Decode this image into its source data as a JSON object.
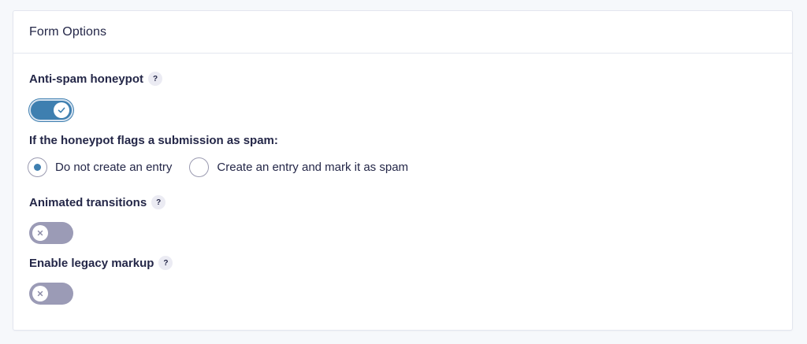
{
  "panel": {
    "title": "Form Options"
  },
  "honeypot": {
    "label": "Anti-spam honeypot",
    "help": "?",
    "enabled": true
  },
  "spam_action": {
    "label": "If the honeypot flags a submission as spam:",
    "options": [
      {
        "label": "Do not create an entry",
        "selected": true
      },
      {
        "label": "Create an entry and mark it as spam",
        "selected": false
      }
    ]
  },
  "animated_transitions": {
    "label": "Animated transitions",
    "help": "?",
    "enabled": false
  },
  "legacy_markup": {
    "label": "Enable legacy markup",
    "help": "?",
    "enabled": false
  },
  "colors": {
    "accent": "#3e7fb0",
    "toggle_off": "#9b9bb6",
    "text": "#242748"
  },
  "icons": {
    "toggle_on": "check-icon",
    "toggle_off": "x-icon"
  }
}
